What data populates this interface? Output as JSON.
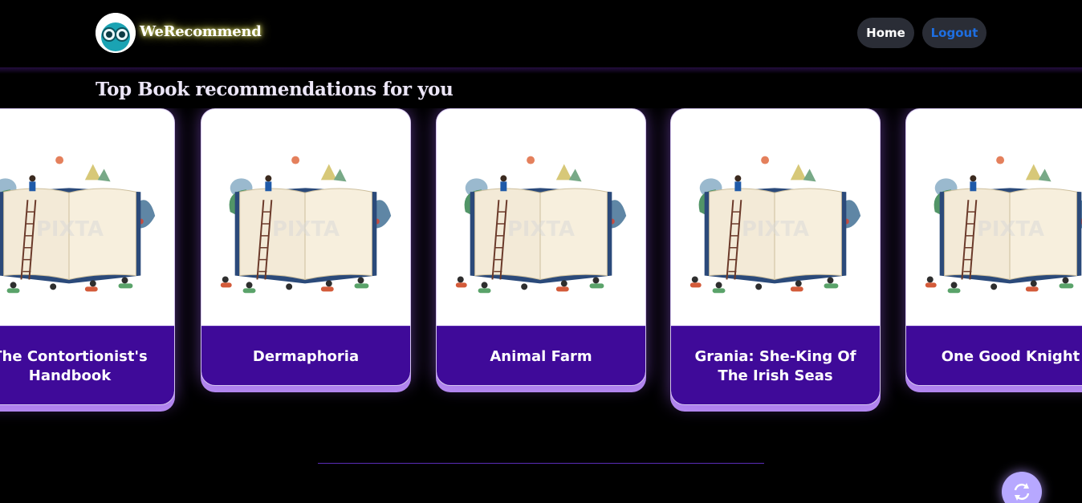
{
  "brand": {
    "name": "WeRecommend",
    "logo_icon": "owl-eyes-icon"
  },
  "nav": {
    "home_label": "Home",
    "logout_label": "Logout"
  },
  "section": {
    "title": "Top Book recommendations for you"
  },
  "books": [
    {
      "title": "The Contortionist's Handbook",
      "image_icon": "open-book-illustration-icon"
    },
    {
      "title": "Dermaphoria",
      "image_icon": "open-book-illustration-icon"
    },
    {
      "title": "Animal Farm",
      "image_icon": "open-book-illustration-icon"
    },
    {
      "title": "Grania: She-King Of The Irish Seas",
      "image_icon": "open-book-illustration-icon"
    },
    {
      "title": "One Good Knight",
      "image_icon": "open-book-illustration-icon"
    }
  ],
  "refresh": {
    "icon": "refresh-icon"
  },
  "colors": {
    "background": "#000000",
    "card_caption": "#3f0a99",
    "accent_glow": "#b78ef0",
    "logout_text": "#1e6ee0"
  }
}
